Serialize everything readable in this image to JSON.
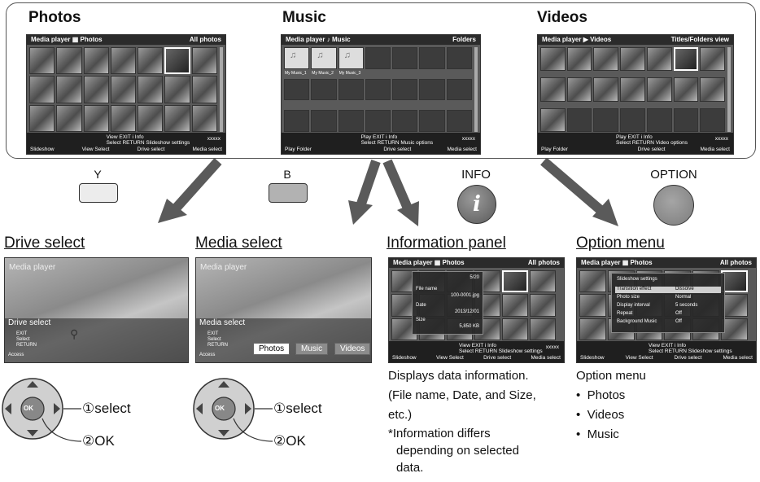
{
  "sections": {
    "photos": {
      "title": "Photos",
      "header_left": "Media player",
      "header_icon": "photos-icon",
      "header_mode": "Photos",
      "header_right": "All photos",
      "footer_line1": "View  EXIT      i Info",
      "footer_line2": "Select  RETURN  Slideshow settings",
      "footer_count": "xxxxx",
      "footer_buttons": [
        "Slideshow",
        "View Select",
        "Drive select",
        "Media select"
      ]
    },
    "music": {
      "title": "Music",
      "header_left": "Media player",
      "header_icon": "music-note-icon",
      "header_mode": "Music",
      "header_right": "Folders",
      "files": [
        "My Music_1",
        "My Music_2",
        "My Music_3"
      ],
      "footer_line1": "Play  EXIT      i Info",
      "footer_line2": "Select  RETURN  Music options",
      "footer_count": "xxxxx",
      "footer_buttons": [
        "Play Folder",
        "",
        "Drive select",
        "Media select"
      ]
    },
    "videos": {
      "title": "Videos",
      "header_left": "Media player",
      "header_icon": "videos-icon",
      "header_mode": "Videos",
      "header_right": "Titles/Folders view",
      "footer_line1": "Play  EXIT      i Info",
      "footer_line2": "Select  RETURN  Video options",
      "footer_count": "xxxxx",
      "footer_buttons": [
        "Play Folder",
        "",
        "Drive select",
        "Media select"
      ]
    }
  },
  "keys": {
    "y": {
      "label": "Y",
      "color": "#e8e8e8"
    },
    "b": {
      "label": "B",
      "color": "#b5b5b5"
    },
    "info": {
      "label": "INFO",
      "glyph": "i"
    },
    "option": {
      "label": "OPTION"
    }
  },
  "bottom": {
    "drive_select": {
      "heading": "Drive select",
      "screen_title": "Media player",
      "overlay": "Drive select",
      "hints": [
        "EXIT",
        "Select",
        "RETURN"
      ],
      "access": "Access"
    },
    "media_select": {
      "heading": "Media select",
      "screen_title": "Media player",
      "overlay": "Media select",
      "hints": [
        "EXIT",
        "Select",
        "RETURN"
      ],
      "access": "Access",
      "tabs": [
        "Photos",
        "Music",
        "Videos"
      ]
    },
    "information_panel": {
      "heading": "Information panel",
      "header_left": "Media player",
      "header_mode": "Photos",
      "header_right": "All photos",
      "panel_rows": [
        [
          "",
          "5/20"
        ],
        [
          "File name",
          "100-0001.jpg"
        ],
        [
          "Date",
          "2013/12/01"
        ],
        [
          "Size",
          "5,850 KB"
        ]
      ],
      "footer_line1": "View  EXIT      i Info",
      "footer_line2": "Select  RETURN  Slideshow settings",
      "footer_buttons": [
        "Slideshow",
        "View Select",
        "Drive select",
        "Media select"
      ],
      "footer_count": "xxxxx",
      "description": [
        "Displays data information.",
        "(File name, Date, and Size,",
        "etc.)",
        "*Information differs",
        "depending on selected",
        "data."
      ]
    },
    "option_menu": {
      "heading": "Option menu",
      "header_left": "Media player",
      "header_mode": "Photos",
      "header_right": "All photos",
      "menu_title": "Slideshow settings",
      "menu_rows": [
        [
          "Transition effect",
          "Dissolve"
        ],
        [
          "Photo size",
          "Normal"
        ],
        [
          "Display interval",
          "5 seconds"
        ],
        [
          "Repeat",
          "Off"
        ],
        [
          "Background Music",
          "Off"
        ]
      ],
      "footer_line1": "View  EXIT      i Info",
      "footer_line2": "Select  RETURN  Slideshow settings",
      "footer_buttons": [
        "Slideshow",
        "View Select",
        "Drive select",
        "Media select"
      ],
      "description_title": "Option menu",
      "items": [
        "Photos",
        "Videos",
        "Music"
      ]
    }
  },
  "remote": {
    "center_label": "OK",
    "step1": "①select",
    "step2": "②OK"
  }
}
